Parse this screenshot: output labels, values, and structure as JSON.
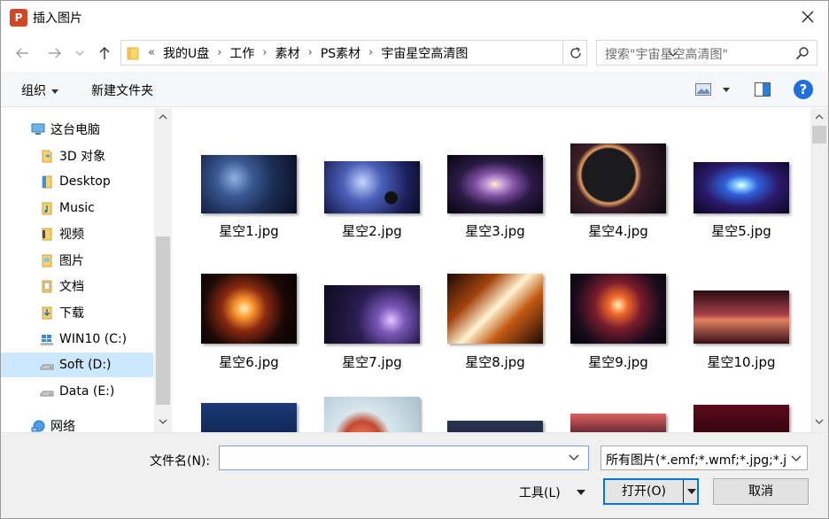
{
  "window": {
    "title": "插入图片",
    "app_icon": "powerpoint-icon"
  },
  "address": {
    "overflow": "«",
    "crumbs": [
      "我的U盘",
      "工作",
      "素材",
      "PS素材",
      "宇宙星空高清图"
    ],
    "search_placeholder": "搜索\"宇宙星空高清图\""
  },
  "toolbar": {
    "organize": "组织",
    "new_folder": "新建文件夹",
    "view_icon": "view-thumbnails-icon",
    "preview_icon": "preview-pane-icon",
    "help": "?"
  },
  "nav": {
    "items": [
      {
        "label": "这台电脑",
        "icon": "computer-icon",
        "selected": false
      },
      {
        "label": "3D 对象",
        "icon": "3d-objects-icon",
        "selected": false
      },
      {
        "label": "Desktop",
        "icon": "desktop-folder-icon",
        "selected": false
      },
      {
        "label": "Music",
        "icon": "music-folder-icon",
        "selected": false
      },
      {
        "label": "视频",
        "icon": "video-folder-icon",
        "selected": false
      },
      {
        "label": "图片",
        "icon": "pictures-folder-icon",
        "selected": false
      },
      {
        "label": "文档",
        "icon": "documents-folder-icon",
        "selected": false
      },
      {
        "label": "下载",
        "icon": "downloads-folder-icon",
        "selected": false
      },
      {
        "label": "WIN10 (C:)",
        "icon": "windows-drive-icon",
        "selected": false
      },
      {
        "label": "Soft (D:)",
        "icon": "drive-icon",
        "selected": true
      },
      {
        "label": "Data (E:)",
        "icon": "drive-icon",
        "selected": false
      },
      {
        "label": "网络",
        "icon": "network-icon",
        "selected": false
      }
    ]
  },
  "files": [
    {
      "name": "星空1.jpg"
    },
    {
      "name": "星空2.jpg"
    },
    {
      "name": "星空3.jpg"
    },
    {
      "name": "星空4.jpg"
    },
    {
      "name": "星空5.jpg"
    },
    {
      "name": "星空6.jpg"
    },
    {
      "name": "星空7.jpg"
    },
    {
      "name": "星空8.jpg"
    },
    {
      "name": "星空9.jpg"
    },
    {
      "name": "星空10.jpg"
    }
  ],
  "bottom": {
    "filename_label": "文件名(N):",
    "filename_value": "",
    "filter": "所有图片(*.emf;*.wmf;*.jpg;*.j",
    "tools": "工具(L)",
    "open": "打开(O)",
    "cancel": "取消"
  },
  "colors": {
    "accent": "#0078d7",
    "selection": "#cce8ff",
    "help": "#1e6fd9"
  }
}
